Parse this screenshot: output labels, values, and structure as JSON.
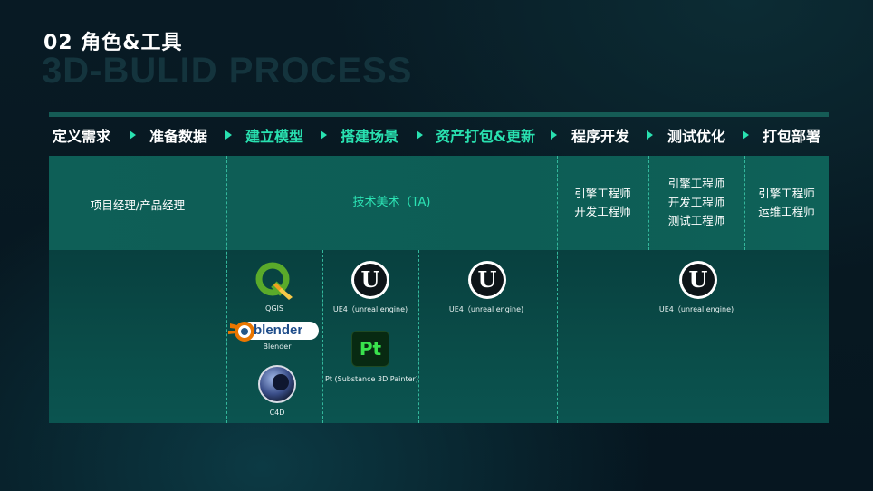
{
  "title": "02 角色&工具",
  "subtitle": "3D-BULID PROCESS",
  "steps": [
    {
      "label": "定义需求",
      "style": "white"
    },
    {
      "label": "准备数据",
      "style": "white"
    },
    {
      "label": "建立模型",
      "style": "green"
    },
    {
      "label": "搭建场景",
      "style": "green"
    },
    {
      "label": "资产打包&更新",
      "style": "green"
    },
    {
      "label": "程序开发",
      "style": "white"
    },
    {
      "label": "测试优化",
      "style": "white"
    },
    {
      "label": "打包部署",
      "style": "white"
    }
  ],
  "roles": {
    "pm": "项目经理/产品经理",
    "ta": "技术美术（TA)",
    "dev_1": "引擎工程师",
    "dev_2": "开发工程师",
    "test_1": "引擎工程师",
    "test_2": "开发工程师",
    "test_3": "测试工程师",
    "deploy_1": "引擎工程师",
    "deploy_2": "运维工程师"
  },
  "tools": {
    "qgis": "QGIS",
    "blender": "Blender",
    "blender_logo": "blender",
    "c4d": "C4D",
    "ue4_a": "UE4（unreal engine)",
    "pt": "Pt (Substance 3D Painter)",
    "pt_logo": "Pt",
    "ue4_b": "UE4（unreal engine)",
    "ue4_c": "UE4（unreal engine)",
    "ue_glyph": "U"
  },
  "icons": [
    "qgis-icon",
    "blender-icon",
    "c4d-icon",
    "unreal-engine-icon",
    "substance-painter-icon",
    "play-arrow-icon"
  ],
  "colors": {
    "accent": "#29e1b0",
    "band": "#0e5f57",
    "panel": "#0a4d49",
    "background": "#081a24"
  }
}
